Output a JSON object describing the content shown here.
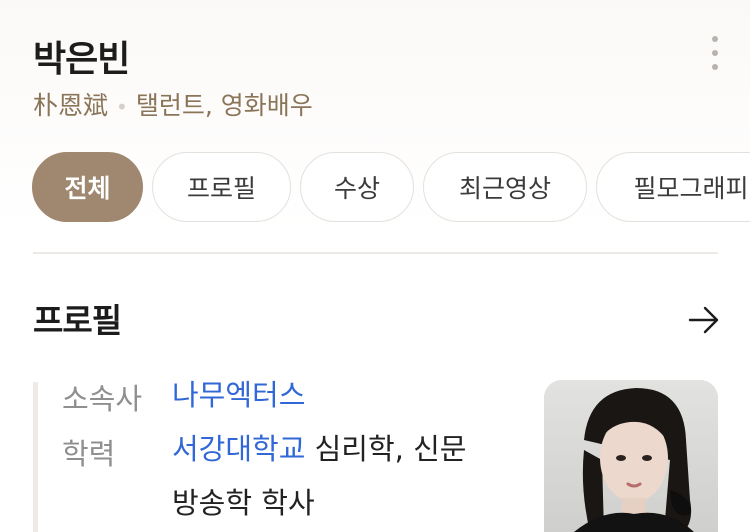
{
  "profile": {
    "name": "박은빈",
    "hanja": "朴恩斌",
    "occupation": "탤런트, 영화배우"
  },
  "tabs": [
    {
      "label": "전체",
      "active": true
    },
    {
      "label": "프로필",
      "active": false
    },
    {
      "label": "수상",
      "active": false
    },
    {
      "label": "최근영상",
      "active": false
    },
    {
      "label": "필모그래피",
      "active": false
    }
  ],
  "section": {
    "title": "프로필"
  },
  "info": {
    "agency_label": "소속사",
    "agency_value": "나무엑터스",
    "education_label": "학력",
    "education_school": "서강대학교",
    "education_major_line1": " 심리학, 신문",
    "education_major_line2": "방송학 학사"
  },
  "colors": {
    "accent": "#a08770",
    "link": "#3167d6",
    "subtitle": "#8a7558"
  },
  "icons": [
    "more-vertical-icon",
    "arrow-right-icon"
  ]
}
